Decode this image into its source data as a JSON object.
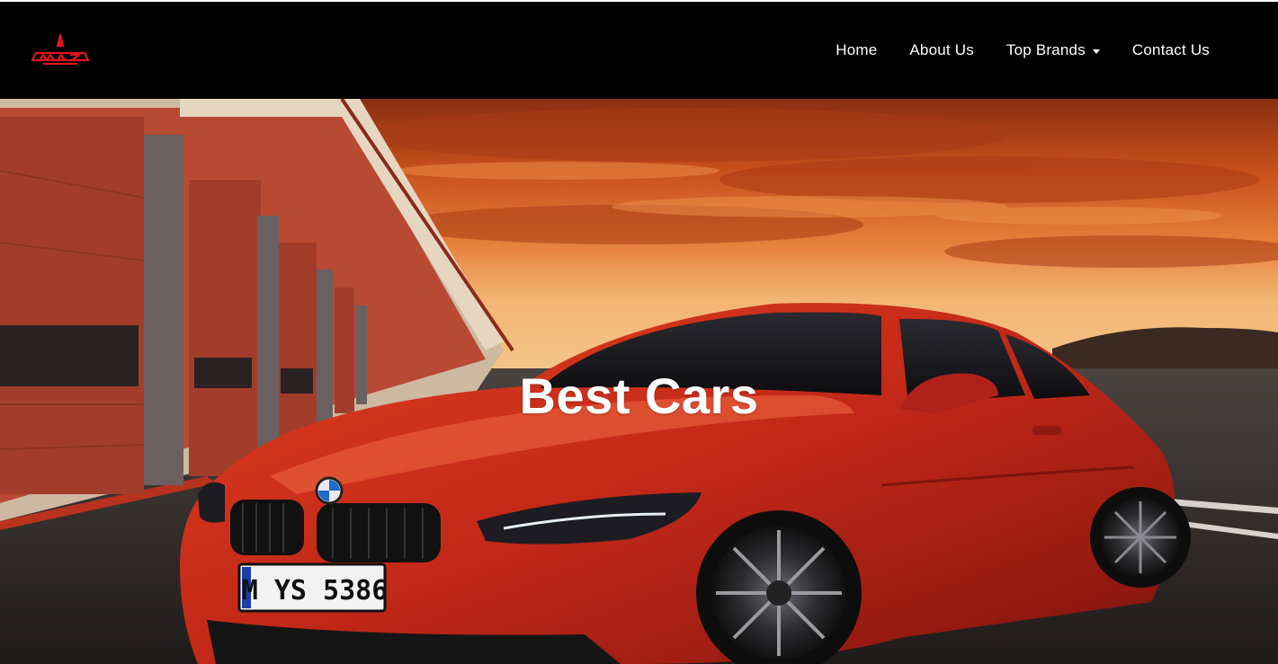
{
  "brand": {
    "logo_text": "MAZ",
    "logo_color": "#e0141e"
  },
  "nav": {
    "items": [
      {
        "label": "Home",
        "dropdown": false
      },
      {
        "label": "About Us",
        "dropdown": false
      },
      {
        "label": "Top Brands",
        "dropdown": true
      },
      {
        "label": "Contact Us",
        "dropdown": false
      }
    ]
  },
  "hero": {
    "title": "Best Cars",
    "plate": "M YS 5386",
    "car_color": "#c8281c",
    "sky_color": "#d9601e"
  }
}
